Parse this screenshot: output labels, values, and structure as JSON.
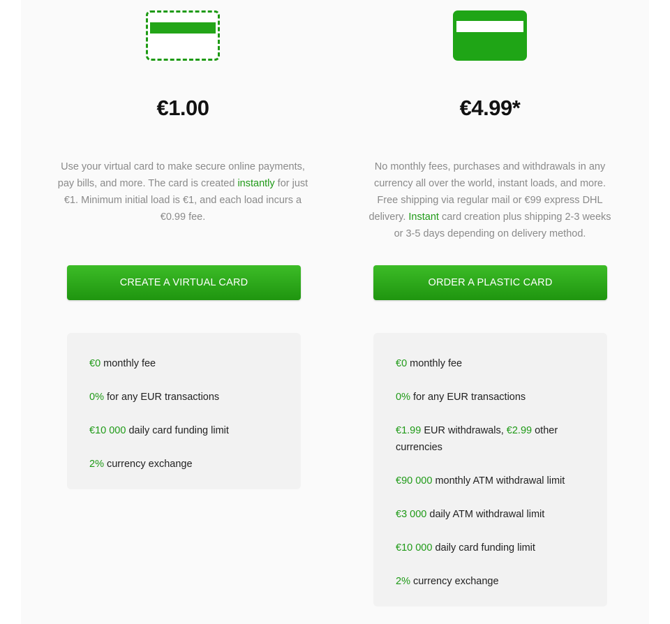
{
  "colors": {
    "accent": "#1f9a17",
    "button_top": "#3cbc27",
    "button_bottom": "#1f950f",
    "description_text": "#8a8a8a",
    "panel_bg": "#f2f2f2"
  },
  "virtual": {
    "icon": "virtual-card-icon",
    "price": "€1.00",
    "description": {
      "part1": "Use your virtual card to make secure online payments, pay bills, and more. The card is created ",
      "highlight": "instantly",
      "part2": " for just €1. Minimum initial load is €1, and each load incurs a €0.99 fee."
    },
    "button_label": "CREATE A VIRTUAL CARD",
    "features": [
      {
        "value": "€0",
        "text": " monthly fee"
      },
      {
        "value": "0%",
        "text": " for any EUR transactions"
      },
      {
        "value": "€10 000",
        "text": " daily card funding limit"
      },
      {
        "value": "2%",
        "text": " currency exchange"
      }
    ]
  },
  "plastic": {
    "icon": "plastic-card-icon",
    "price": "€4.99*",
    "description": {
      "part1": "No monthly fees, purchases and withdrawals in any currency all over the world, instant loads, and more. Free shipping via regular mail or €99 express DHL delivery. ",
      "highlight": "Instant",
      "part2": " card creation plus shipping 2-3 weeks or 3-5 days depending on delivery method."
    },
    "button_label": "ORDER A PLASTIC CARD",
    "features": [
      {
        "value": "€0",
        "text": " monthly fee"
      },
      {
        "value": "0%",
        "text": " for any EUR transactions"
      },
      {
        "value": "€1.99",
        "text": " EUR withdrawals, ",
        "value2": "€2.99",
        "text2": " other currencies"
      },
      {
        "value": "€90 000",
        "text": " monthly ATM withdrawal limit"
      },
      {
        "value": "€3 000",
        "text": " daily ATM withdrawal limit"
      },
      {
        "value": "€10 000",
        "text": " daily card funding limit"
      },
      {
        "value": "2%",
        "text": " currency exchange"
      }
    ]
  }
}
